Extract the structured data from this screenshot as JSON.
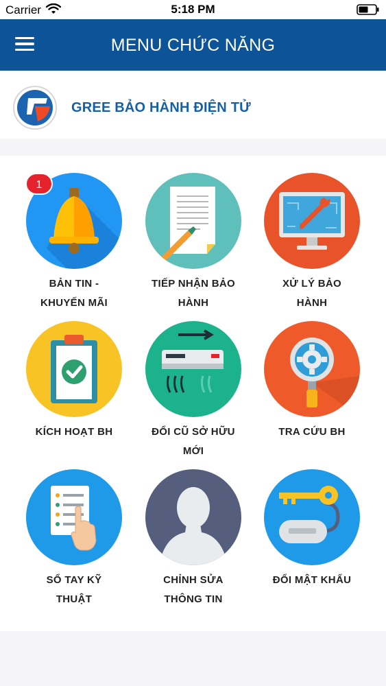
{
  "status_bar": {
    "carrier": "Carrier",
    "time": "5:18 PM"
  },
  "nav": {
    "title": "MENU CHỨC NĂNG"
  },
  "brand": {
    "title": "GREE BẢO HÀNH ĐIỆN TỬ"
  },
  "badge": {
    "count": "1"
  },
  "menu": [
    {
      "line1": "BẢN TIN -",
      "line2": "KHUYẾN MÃI",
      "icon": "bell-icon",
      "color": "#2196f3"
    },
    {
      "line1": "TIẾP NHẬN BẢO",
      "line2": "HÀNH",
      "icon": "document-icon",
      "color": "#5fbfba"
    },
    {
      "line1": "XỬ LÝ BẢO",
      "line2": "HÀNH",
      "icon": "monitor-wrench-icon",
      "color": "#e8532a"
    },
    {
      "line1": "KÍCH HOẠT BH",
      "line2": "",
      "icon": "clipboard-check-icon",
      "color": "#f7c325"
    },
    {
      "line1": "ĐỔI CŨ SỞ HỮU",
      "line2": "MỚI",
      "icon": "air-conditioner-icon",
      "color": "#1bb28c"
    },
    {
      "line1": "TRA CỨU BH",
      "line2": "",
      "icon": "magnifier-gear-icon",
      "color": "#ef5a2b"
    },
    {
      "line1": "SỔ TAY KỸ",
      "line2": "THUẬT",
      "icon": "manual-hand-icon",
      "color": "#1e9ae8"
    },
    {
      "line1": "CHỈNH SỬA",
      "line2": "THÔNG TIN",
      "icon": "user-silhouette-icon",
      "color": "#555f7d"
    },
    {
      "line1": "ĐỔI MẬT KHẨU",
      "line2": "",
      "icon": "key-icon",
      "color": "#1e9ae8"
    }
  ],
  "colors": {
    "nav_bg": "#0c5497",
    "brand_text": "#1660a6",
    "badge": "#e5232c"
  }
}
